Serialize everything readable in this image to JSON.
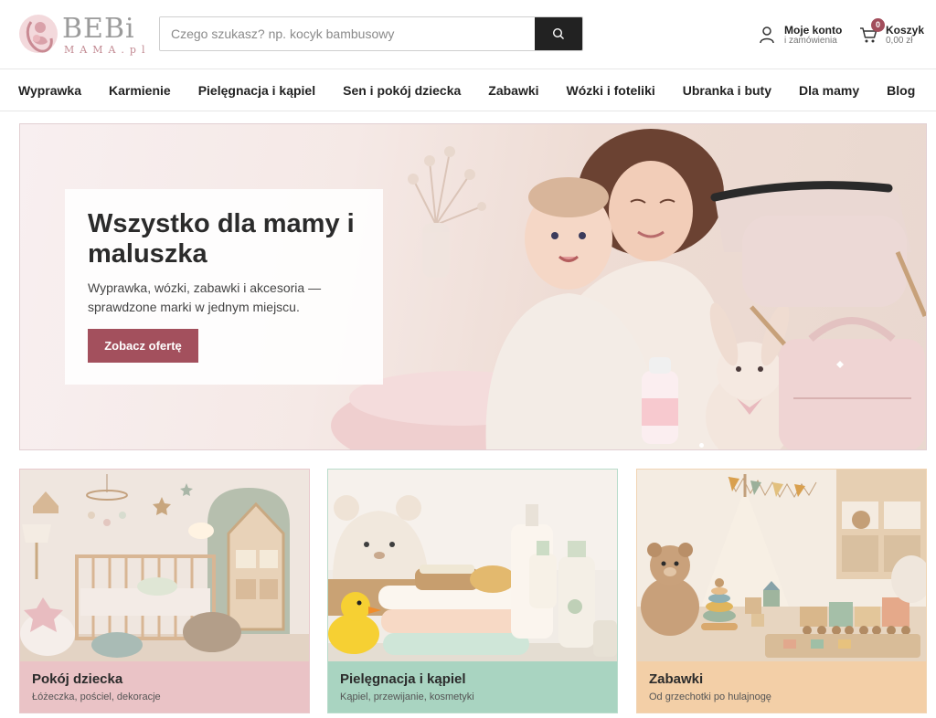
{
  "logo": {
    "text": "BEBi",
    "sub": "MAMA.pl"
  },
  "search": {
    "placeholder": "Czego szukasz? np. kocyk bambusowy",
    "icon": "search-icon"
  },
  "account": {
    "title": "Moje konto",
    "subtitle": "i zamówienia",
    "icon": "user-icon"
  },
  "cart": {
    "title": "Koszyk",
    "total": "0,00 zł",
    "count": "0",
    "icon": "cart-icon"
  },
  "nav": {
    "items": [
      {
        "label": "Wyprawka"
      },
      {
        "label": "Karmienie"
      },
      {
        "label": "Pielęgnacja i kąpiel"
      },
      {
        "label": "Sen i pokój dziecka"
      },
      {
        "label": "Zabawki"
      },
      {
        "label": "Wózki i foteliki"
      },
      {
        "label": "Ubranka i buty"
      },
      {
        "label": "Dla mamy"
      },
      {
        "label": "Blog"
      }
    ]
  },
  "hero": {
    "title": "Wszystko dla mamy i maluszka",
    "text": "Wyprawka, wózki, zabawki i akcesoria — sprawdzone marki w jednym miejscu.",
    "button": "Zobacz ofertę"
  },
  "categories": [
    {
      "title": "Pokój dziecka",
      "subtitle": "Łóżeczka, pościel, dekoracje"
    },
    {
      "title": "Pielęgnacja i kąpiel",
      "subtitle": "Kąpiel, przewijanie, kosmetyki"
    },
    {
      "title": "Zabawki",
      "subtitle": "Od grzechotki po hulajnogę"
    }
  ],
  "colors": {
    "accent": "#a3505d",
    "card_pink": "#eac3c6",
    "card_mint": "#a9d4c1",
    "card_peach": "#f3cfa7"
  }
}
